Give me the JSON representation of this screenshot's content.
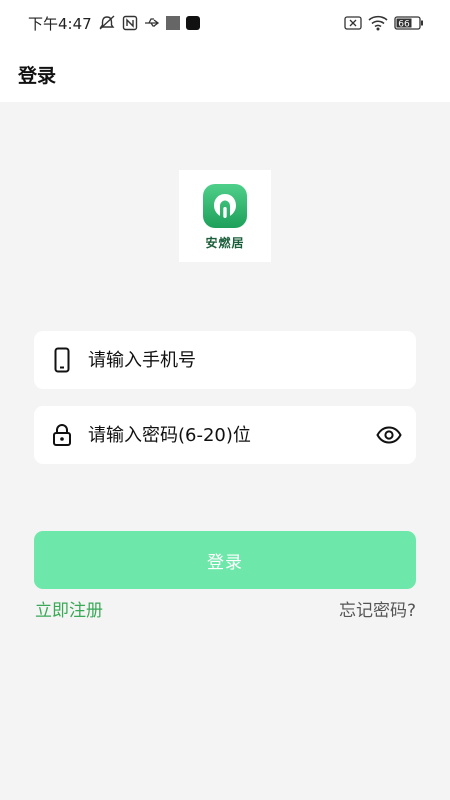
{
  "status_bar": {
    "time": "下午4:47",
    "battery": "66",
    "icons": [
      "mute-icon",
      "nfc-icon",
      "usb-icon",
      "notification-square-icon",
      "notification-app-icon",
      "no-sim-icon",
      "wifi-icon",
      "battery-icon"
    ]
  },
  "header": {
    "title": "登录"
  },
  "logo": {
    "name": "安燃居"
  },
  "phone_field": {
    "placeholder": "请输入手机号",
    "icon": "phone-icon"
  },
  "password_field": {
    "placeholder": "请输入密码(6-20)位",
    "icon": "lock-icon",
    "toggle_icon": "eye-icon"
  },
  "login_button": {
    "label": "登录"
  },
  "links": {
    "register": "立即注册",
    "forgot": "忘记密码?"
  },
  "colors": {
    "accent": "#6ee8aa",
    "link_green": "#3aa957",
    "background": "#f4f4f4",
    "logo_green": "#1fa05a"
  }
}
